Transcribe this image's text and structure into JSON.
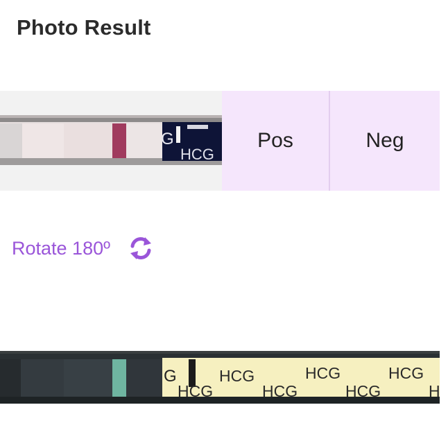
{
  "header": {
    "title": "Photo Result"
  },
  "result": {
    "pos_label": "Pos",
    "neg_label": "Neg",
    "strip_brand": "HCG",
    "strip_brand_partial": "G"
  },
  "rotate": {
    "label": "Rotate 180º",
    "icon": "rotate-icon"
  },
  "strip2": {
    "brand_texts": [
      "G",
      "HCG",
      "HCG",
      "HCG",
      "HCG",
      "HCG",
      "HCG",
      "H"
    ]
  },
  "colors": {
    "accent": "#9a55d9",
    "button_bg": "#f5e6fc",
    "strip2_label_bg": "#f6f0c0"
  }
}
